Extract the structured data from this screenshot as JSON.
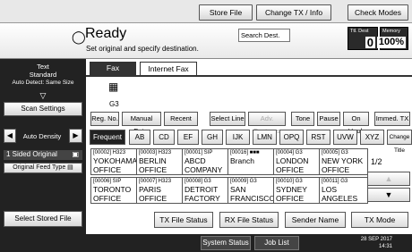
{
  "topbar": {
    "store_file": "Store File",
    "change_tx_info": "Change TX / Info",
    "check_modes": "Check Modes"
  },
  "status": {
    "title": "Ready",
    "subtitle": "Set original and specify destination.",
    "search_dest": "Search Dest.",
    "dest_label": "Ttl. Dest",
    "dest_value": "0",
    "memory_label": "Memory",
    "memory_value": "100%"
  },
  "left_panel": {
    "text_mode": "Text",
    "resolution": "Standard",
    "auto_detect": "Auto Detect: Same Size",
    "scan_settings": "Scan Settings",
    "auto_density": "Auto Density",
    "sided": "1 Sided Original",
    "feed_type": "Original Feed Type",
    "select_stored": "Select Stored File"
  },
  "tabs": {
    "fax": "Fax",
    "internet_fax": "Internet Fax"
  },
  "line": {
    "icon": "fax-line-icon",
    "label": "G3"
  },
  "action_row": {
    "reg_no": "Reg. No.",
    "manual_entry": "Manual Entry",
    "recent": "Recent",
    "select_line": "Select Line",
    "adv_features": "Adv. Features",
    "tone": "Tone",
    "pause": "Pause",
    "on_hook": "On Hook",
    "immed_tx": "Immed. TX"
  },
  "index_tabs": [
    "Frequent",
    "AB",
    "CD",
    "EF",
    "GH",
    "IJK",
    "LMN",
    "OPQ",
    "RST",
    "UVW",
    "XYZ"
  ],
  "change_title": "Change Title",
  "entries": [
    {
      "meta": "[00002] H323",
      "name": "YOKOHAMA OFFICE"
    },
    {
      "meta": "[00003] H323",
      "name": "BERLIN OFFICE"
    },
    {
      "meta": "[00001] SIP",
      "name": "ABCD COMPANY"
    },
    {
      "meta": "[00016] ■■■",
      "name": "Branch"
    },
    {
      "meta": "[00004] G3",
      "name": "LONDON OFFICE"
    },
    {
      "meta": "[00005] G3",
      "name": "NEW YORK OFFICE"
    },
    {
      "meta": "[00006] SIP",
      "name": "TORONTO OFFICE"
    },
    {
      "meta": "[00007] H323",
      "name": "PARIS OFFICE"
    },
    {
      "meta": "[00008] G3",
      "name": "DETROIT FACTORY"
    },
    {
      "meta": "[00009] G3",
      "name": "SAN FRANCISCO OFFICE"
    },
    {
      "meta": "[00010] G3",
      "name": "SYDNEY OFFICE"
    },
    {
      "meta": "[00011] G3",
      "name": "LOS ANGELES FACT"
    }
  ],
  "pager": "1/2",
  "bottom": {
    "tx_file_status": "TX File Status",
    "rx_file_status": "RX File Status",
    "sender_name": "Sender Name",
    "tx_mode": "TX Mode"
  },
  "footer": {
    "system_status": "System Status",
    "job_list": "Job List",
    "date": "28 SEP 2017",
    "time": "14:31"
  }
}
